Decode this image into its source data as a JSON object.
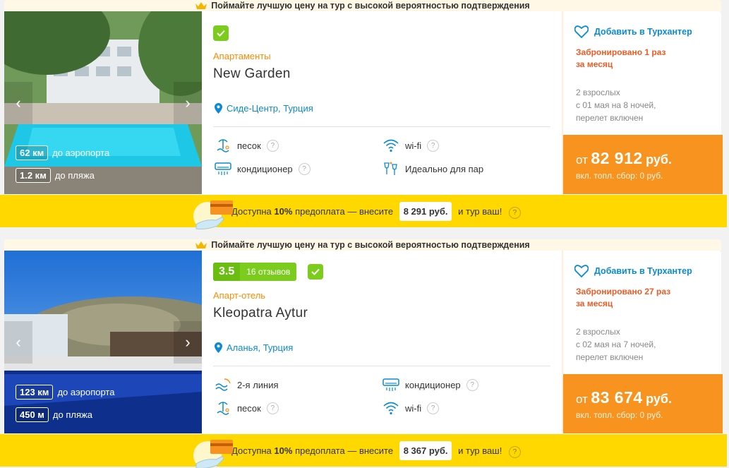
{
  "promo_banner": "Поймайте лучшую цену на тур с высокой вероятностью подтверждения",
  "favorite_label": "Добавить в Турхантер",
  "hotels": [
    {
      "type": "Апартаменты",
      "name": "New Garden",
      "location": "Сиде-Центр, Турция",
      "airport_distance": "62 км",
      "airport_label": "до аэропорта",
      "beach_distance": "1.2 км",
      "beach_label": "до пляжа",
      "amenities": [
        {
          "icon": "beach-shower-icon",
          "label": "песок"
        },
        {
          "icon": "wifi-icon",
          "label": "wi-fi"
        },
        {
          "icon": "air-conditioner-icon",
          "label": "кондиционер"
        },
        {
          "icon": "couple-glasses-icon",
          "label": "Идеально для пар"
        }
      ],
      "booked_line1": "Забронировано 1 раз",
      "booked_line2": "за месяц",
      "trip_line1": "2 взрослых",
      "trip_line2": "с 01 мая на 8 ночей,",
      "trip_line3": "перелет включен",
      "price_prefix": "от",
      "price": "82 912",
      "currency": "руб.",
      "fee": "вкл. топл. сбор: 0 руб.",
      "prepay_lead": "Доступна",
      "prepay_percent": "10%",
      "prepay_mid": "предоплата — внесите",
      "prepay_amount": "8 291 руб.",
      "prepay_tail": "и тур ваш!"
    },
    {
      "type": "Апарт-отель",
      "name": "Kleopatra Aytur",
      "rating": "3.5",
      "reviews": "16 отзывов",
      "location": "Аланья, Турция",
      "airport_distance": "123 км",
      "airport_label": "до аэропорта",
      "beach_distance": "450 м",
      "beach_label": "до пляжа",
      "amenities": [
        {
          "icon": "beach-line-icon",
          "label": "2-я линия"
        },
        {
          "icon": "air-conditioner-icon",
          "label": "кондиционер"
        },
        {
          "icon": "beach-shower-icon",
          "label": "песок"
        },
        {
          "icon": "wifi-icon",
          "label": "wi-fi"
        }
      ],
      "booked_line1": "Забронировано 27 раз",
      "booked_line2": "за месяц",
      "trip_line1": "2 взрослых",
      "trip_line2": "с 02 мая на 7 ночей,",
      "trip_line3": "перелет включен",
      "price_prefix": "от",
      "price": "83 674",
      "currency": "руб.",
      "fee": "вкл. топл. сбор: 0 руб.",
      "prepay_lead": "Доступна",
      "prepay_percent": "10%",
      "prepay_mid": "предоплата — внесите",
      "prepay_amount": "8 367 руб.",
      "prepay_tail": "и тур ваш!"
    }
  ],
  "colors": {
    "accent_orange": "#f7931e",
    "link_blue": "#0a8bd1",
    "green": "#7ccc1e",
    "prepay_yellow": "#ffd800",
    "booked_red": "#f05a22"
  }
}
